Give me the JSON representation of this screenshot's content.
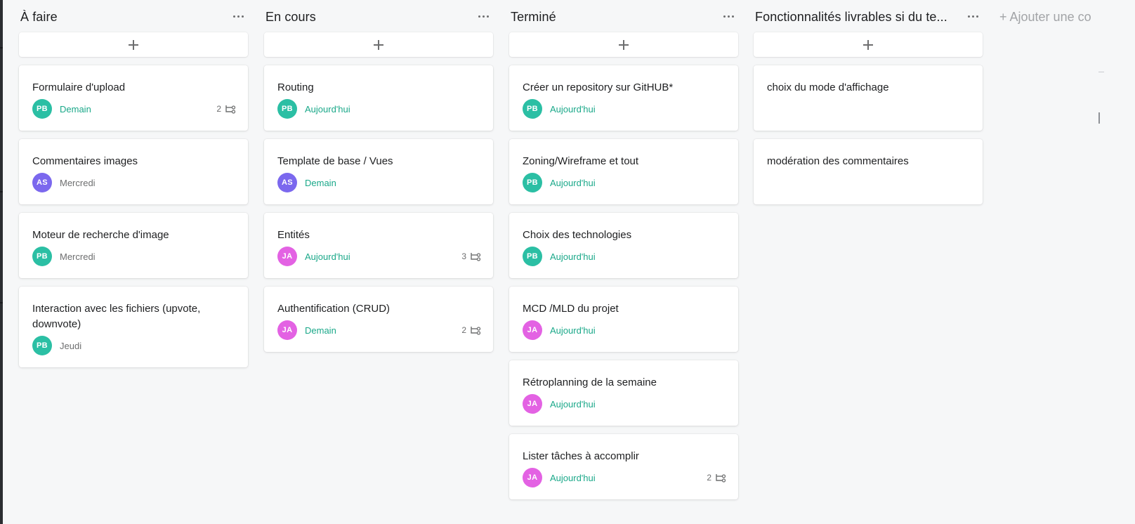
{
  "colors": {
    "avatar_pb": "#2bbfa4",
    "avatar_as": "#7b68ee",
    "avatar_ja": "#e362e3",
    "due_soon": "#1aa889",
    "due_later": "#6d6e6f"
  },
  "board": {
    "add_section_label": "+ Ajouter une co",
    "columns": [
      {
        "title": "À faire",
        "cards": [
          {
            "title": "Formulaire d'upload",
            "avatar": "PB",
            "due": "Demain",
            "subtasks": "2"
          },
          {
            "title": "Commentaires images",
            "avatar": "AS",
            "due": "Mercredi"
          },
          {
            "title": "Moteur de recherche d'image",
            "avatar": "PB",
            "due": "Mercredi"
          },
          {
            "title": "Interaction avec les fichiers (upvote, downvote)",
            "avatar": "PB",
            "due": "Jeudi"
          }
        ]
      },
      {
        "title": "En cours",
        "cards": [
          {
            "title": "Routing",
            "avatar": "PB",
            "due": "Aujourd'hui"
          },
          {
            "title": "Template de base / Vues",
            "avatar": "AS",
            "due": "Demain"
          },
          {
            "title": "Entités",
            "avatar": "JA",
            "due": "Aujourd'hui",
            "subtasks": "3"
          },
          {
            "title": "Authentification (CRUD)",
            "avatar": "JA",
            "due": "Demain",
            "subtasks": "2"
          }
        ]
      },
      {
        "title": "Terminé",
        "cards": [
          {
            "title": "Créer un repository sur GitHUB*",
            "avatar": "PB",
            "due": "Aujourd'hui"
          },
          {
            "title": "Zoning/Wireframe et tout",
            "avatar": "PB",
            "due": "Aujourd'hui"
          },
          {
            "title": "Choix des technologies",
            "avatar": "PB",
            "due": "Aujourd'hui"
          },
          {
            "title": "MCD /MLD du projet",
            "avatar": "JA",
            "due": "Aujourd'hui"
          },
          {
            "title": "Rétroplanning de la semaine",
            "avatar": "JA",
            "due": "Aujourd'hui"
          },
          {
            "title": "Lister tâches à accomplir",
            "avatar": "JA",
            "due": "Aujourd'hui",
            "subtasks": "2"
          }
        ]
      },
      {
        "title": "Fonctionnalités livrables si du te...",
        "cards": [
          {
            "title": "choix du mode d'affichage"
          },
          {
            "title": "modération des commentaires"
          }
        ]
      }
    ]
  }
}
